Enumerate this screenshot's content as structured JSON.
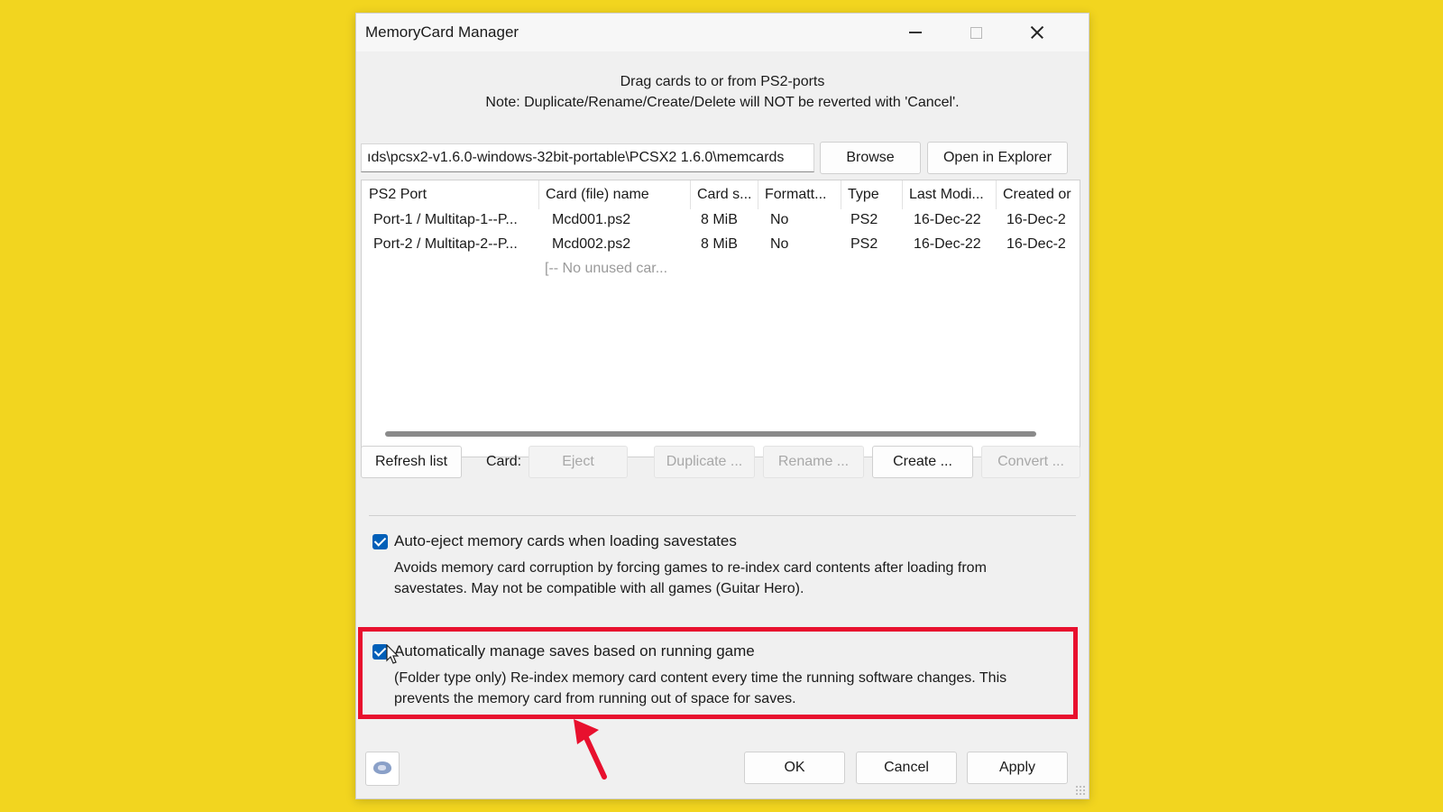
{
  "window": {
    "title": "MemoryCard Manager"
  },
  "info": {
    "line1": "Drag cards to or from PS2-ports",
    "line2": "Note: Duplicate/Rename/Create/Delete will NOT be reverted with 'Cancel'."
  },
  "path": {
    "value": "ıds\\pcsx2-v1.6.0-windows-32bit-portable\\PCSX2 1.6.0\\memcards",
    "browse_label": "Browse",
    "open_explorer_label": "Open in Explorer"
  },
  "table": {
    "columns": [
      "PS2 Port",
      "Card (file) name",
      "Card s...",
      "Formatt...",
      "Type",
      "Last Modi...",
      "Created or"
    ],
    "rows": [
      [
        "Port-1 / Multitap-1--P...",
        "Mcd001.ps2",
        "8 MiB",
        "No",
        "PS2",
        "16-Dec-22",
        "16-Dec-2"
      ],
      [
        "Port-2 / Multitap-2--P...",
        "Mcd002.ps2",
        "8 MiB",
        "No",
        "PS2",
        "16-Dec-22",
        "16-Dec-2"
      ]
    ],
    "placeholder_row": "[-- No unused car..."
  },
  "card_actions": {
    "refresh_label": "Refresh list",
    "card_label": "Card:",
    "eject_label": "Eject",
    "duplicate_label": "Duplicate ...",
    "rename_label": "Rename ...",
    "create_label": "Create ...",
    "convert_label": "Convert ..."
  },
  "options": {
    "auto_eject": {
      "checked": true,
      "label": "Auto-eject memory cards when loading savestates",
      "desc_line1": "Avoids memory card corruption by forcing games to re-index card contents after loading from",
      "desc_line2": "savestates.  May not be compatible with all games (Guitar Hero)."
    },
    "auto_manage": {
      "checked": true,
      "label": "Automatically manage saves based on running game",
      "desc_line1": "(Folder type only) Re-index memory card content every time the running software changes. This",
      "desc_line2": "prevents the memory card from running out of space for saves."
    }
  },
  "footer": {
    "ok_label": "OK",
    "cancel_label": "Cancel",
    "apply_label": "Apply"
  },
  "colors": {
    "background": "#f2d51f",
    "highlight": "#e8102e",
    "checkbox": "#005fb8"
  },
  "icons": {
    "app": "pcsx2-app-icon",
    "cursor": "mouse-pointer-icon",
    "annotation": "red-arrow-icon"
  }
}
